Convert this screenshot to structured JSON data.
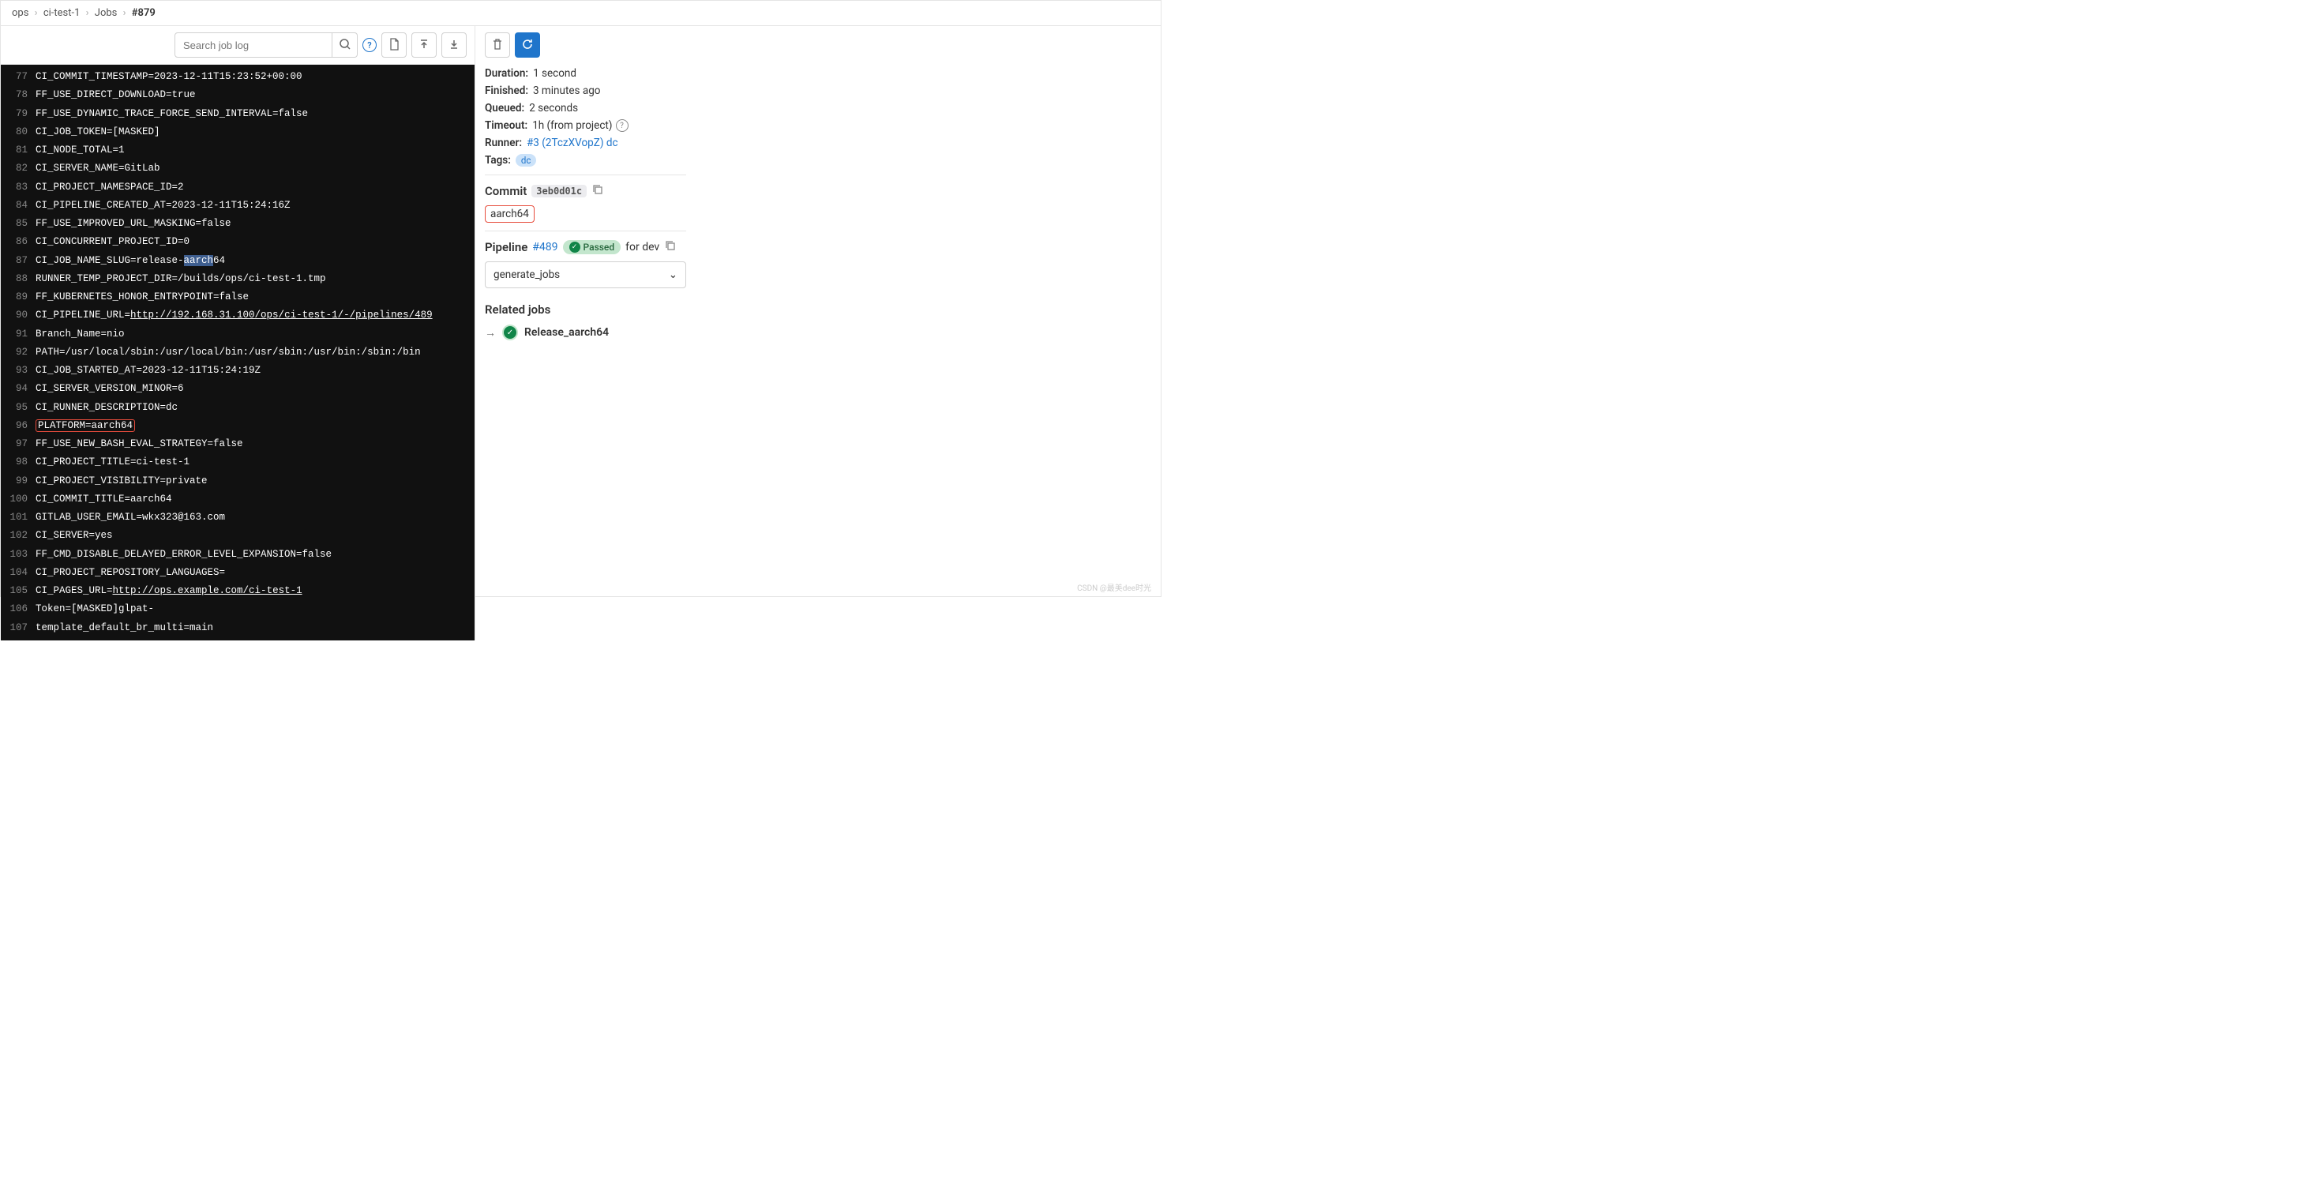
{
  "breadcrumbs": {
    "item0": "ops",
    "item1": "ci-test-1",
    "item2": "Jobs",
    "current": "#879"
  },
  "toolbar": {
    "search_placeholder": "Search job log"
  },
  "log": {
    "lines": [
      {
        "num": "77",
        "text": "CI_COMMIT_TIMESTAMP=2023-12-11T15:23:52+00:00"
      },
      {
        "num": "78",
        "text": "FF_USE_DIRECT_DOWNLOAD=true"
      },
      {
        "num": "79",
        "text": "FF_USE_DYNAMIC_TRACE_FORCE_SEND_INTERVAL=false"
      },
      {
        "num": "80",
        "text": "CI_JOB_TOKEN=[MASKED]"
      },
      {
        "num": "81",
        "text": "CI_NODE_TOTAL=1"
      },
      {
        "num": "82",
        "text": "CI_SERVER_NAME=GitLab"
      },
      {
        "num": "83",
        "text": "CI_PROJECT_NAMESPACE_ID=2"
      },
      {
        "num": "84",
        "text": "CI_PIPELINE_CREATED_AT=2023-12-11T15:24:16Z"
      },
      {
        "num": "85",
        "text": "FF_USE_IMPROVED_URL_MASKING=false"
      },
      {
        "num": "86",
        "text": "CI_CONCURRENT_PROJECT_ID=0"
      },
      {
        "num": "87",
        "prefix": "CI_JOB_NAME_SLUG=release-",
        "sel": "aarch",
        "suffix": "64",
        "hasSel": true
      },
      {
        "num": "88",
        "text": "RUNNER_TEMP_PROJECT_DIR=/builds/ops/ci-test-1.tmp"
      },
      {
        "num": "89",
        "text": "FF_KUBERNETES_HONOR_ENTRYPOINT=false"
      },
      {
        "num": "90",
        "prefix": "CI_PIPELINE_URL=",
        "link": "http://192.168.31.100/ops/ci-test-1/-/pipelines/489",
        "hasLink": true
      },
      {
        "num": "91",
        "text": "Branch_Name=nio"
      },
      {
        "num": "92",
        "text": "PATH=/usr/local/sbin:/usr/local/bin:/usr/sbin:/usr/bin:/sbin:/bin"
      },
      {
        "num": "93",
        "text": "CI_JOB_STARTED_AT=2023-12-11T15:24:19Z"
      },
      {
        "num": "94",
        "text": "CI_SERVER_VERSION_MINOR=6"
      },
      {
        "num": "95",
        "text": "CI_RUNNER_DESCRIPTION=dc"
      },
      {
        "num": "96",
        "text": "PLATFORM=aarch64",
        "hasBox": true
      },
      {
        "num": "97",
        "text": "FF_USE_NEW_BASH_EVAL_STRATEGY=false"
      },
      {
        "num": "98",
        "text": "CI_PROJECT_TITLE=ci-test-1"
      },
      {
        "num": "99",
        "text": "CI_PROJECT_VISIBILITY=private"
      },
      {
        "num": "100",
        "text": "CI_COMMIT_TITLE=aarch64"
      },
      {
        "num": "101",
        "text": "GITLAB_USER_EMAIL=wkx323@163.com"
      },
      {
        "num": "102",
        "text": "CI_SERVER=yes"
      },
      {
        "num": "103",
        "text": "FF_CMD_DISABLE_DELAYED_ERROR_LEVEL_EXPANSION=false"
      },
      {
        "num": "104",
        "text": "CI_PROJECT_REPOSITORY_LANGUAGES="
      },
      {
        "num": "105",
        "prefix": "CI_PAGES_URL=",
        "link": "http://ops.example.com/ci-test-1",
        "hasLink": true
      },
      {
        "num": "106",
        "text": "Token=[MASKED]glpat-"
      },
      {
        "num": "107",
        "text": "template_default_br_multi=main"
      }
    ]
  },
  "meta": {
    "duration_k": "Duration:",
    "duration_v": "1 second",
    "finished_k": "Finished:",
    "finished_v": "3 minutes ago",
    "queued_k": "Queued:",
    "queued_v": "2 seconds",
    "timeout_k": "Timeout:",
    "timeout_v": "1h (from project)",
    "runner_k": "Runner:",
    "runner_v": "#3 (2TczXVopZ) dc",
    "tags_k": "Tags:",
    "tag": "dc"
  },
  "commit": {
    "title": "Commit",
    "sha": "3eb0d01c",
    "message": "aarch64"
  },
  "pipeline": {
    "title": "Pipeline",
    "id": "#489",
    "status": "Passed",
    "for": "for dev",
    "stage": "generate_jobs"
  },
  "related": {
    "title": "Related jobs",
    "job": "Release_aarch64"
  },
  "watermark": "CSDN @最美dee时光"
}
